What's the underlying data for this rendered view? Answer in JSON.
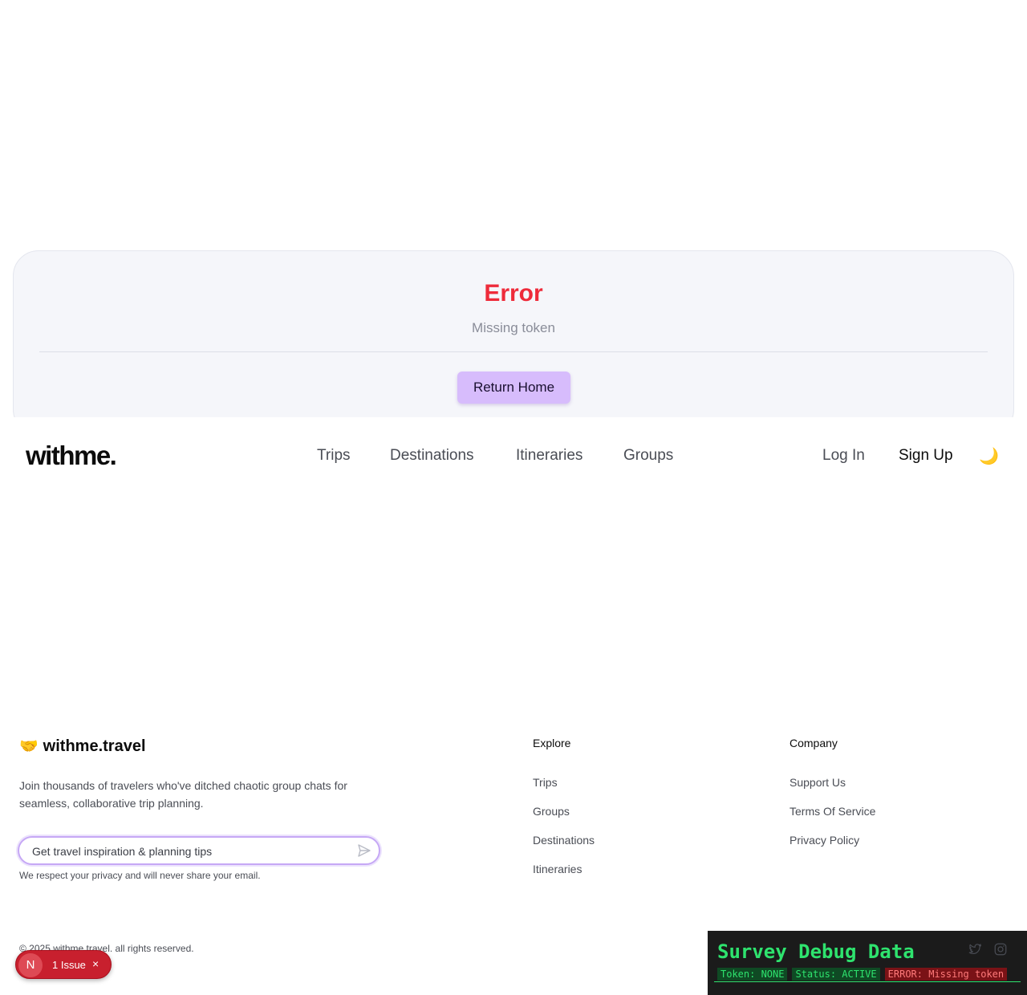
{
  "error_card": {
    "title": "Error",
    "message": "Missing token",
    "button_label": "Return Home"
  },
  "navbar": {
    "logo": "withme.",
    "links": [
      "Trips",
      "Destinations",
      "Itineraries",
      "Groups"
    ],
    "login": "Log In",
    "signup": "Sign Up",
    "theme_icon": "moon-icon"
  },
  "footer": {
    "brand_emoji": "🤝",
    "brand": "withme.travel",
    "description": "Join thousands of travelers who've ditched chaotic group chats for seamless, collaborative trip planning.",
    "newsletter_placeholder": "Get travel inspiration & planning tips",
    "privacy_note": "We respect your privacy and will never share your email.",
    "explore": {
      "heading": "Explore",
      "links": [
        "Trips",
        "Groups",
        "Destinations",
        "Itineraries"
      ]
    },
    "company": {
      "heading": "Company",
      "links": [
        "Support Us",
        "Terms Of Service",
        "Privacy Policy"
      ]
    },
    "copyright": "© 2025 withme.travel. all rights reserved.",
    "social_icons": [
      "twitter-icon",
      "instagram-icon"
    ]
  },
  "issue_badge": {
    "avatar_letter": "N",
    "label": "1 Issue",
    "close": "×",
    "color": "#c8202e"
  },
  "debug_panel": {
    "title": "Survey Debug Data",
    "token": "Token: NONE",
    "status": "Status: ACTIVE",
    "error": "ERROR: Missing token",
    "accent_color": "#2ee36e"
  },
  "colors": {
    "error": "#ee2b3a",
    "button": "#d7bcfc",
    "card_bg": "#f5f6fa"
  }
}
